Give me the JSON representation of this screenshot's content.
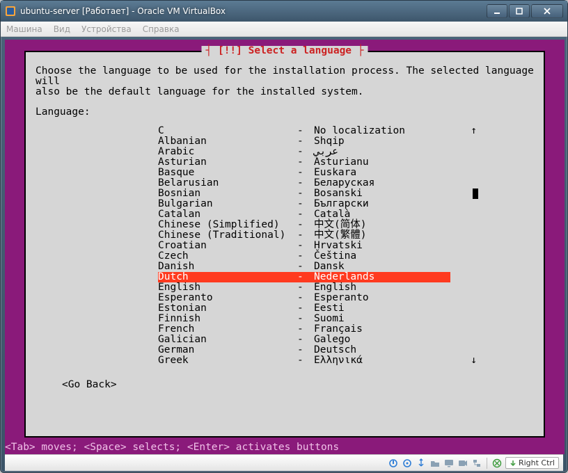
{
  "window": {
    "title": "ubuntu-server [Работает] - Oracle VM VirtualBox"
  },
  "menubar": {
    "items": [
      "Машина",
      "Вид",
      "Устройства",
      "Справка"
    ]
  },
  "installer": {
    "dialog_title": "[!!] Select a language",
    "prompt_line1": "Choose the language to be used for the installation process. The selected language will",
    "prompt_line2": "also be the default language for the installed system.",
    "language_label": "Language:",
    "go_back": "<Go Back>",
    "help_bar": "<Tab> moves; <Space> selects; <Enter> activates buttons",
    "selected_index": 14,
    "languages": [
      {
        "name": "C",
        "native": "No localization"
      },
      {
        "name": "Albanian",
        "native": "Shqip"
      },
      {
        "name": "Arabic",
        "native": "عربي"
      },
      {
        "name": "Asturian",
        "native": "Asturianu"
      },
      {
        "name": "Basque",
        "native": "Euskara"
      },
      {
        "name": "Belarusian",
        "native": "Беларуская"
      },
      {
        "name": "Bosnian",
        "native": "Bosanski"
      },
      {
        "name": "Bulgarian",
        "native": "Български"
      },
      {
        "name": "Catalan",
        "native": "Català"
      },
      {
        "name": "Chinese (Simplified)",
        "native": "中文(简体)"
      },
      {
        "name": "Chinese (Traditional)",
        "native": "中文(繁體)"
      },
      {
        "name": "Croatian",
        "native": "Hrvatski"
      },
      {
        "name": "Czech",
        "native": "Čeština"
      },
      {
        "name": "Danish",
        "native": "Dansk"
      },
      {
        "name": "Dutch",
        "native": "Nederlands"
      },
      {
        "name": "English",
        "native": "English"
      },
      {
        "name": "Esperanto",
        "native": "Esperanto"
      },
      {
        "name": "Estonian",
        "native": "Eesti"
      },
      {
        "name": "Finnish",
        "native": "Suomi"
      },
      {
        "name": "French",
        "native": "Français"
      },
      {
        "name": "Galician",
        "native": "Galego"
      },
      {
        "name": "German",
        "native": "Deutsch"
      },
      {
        "name": "Greek",
        "native": "Ελληνικά"
      }
    ]
  },
  "statusbar": {
    "hostkey": "Right Ctrl"
  }
}
